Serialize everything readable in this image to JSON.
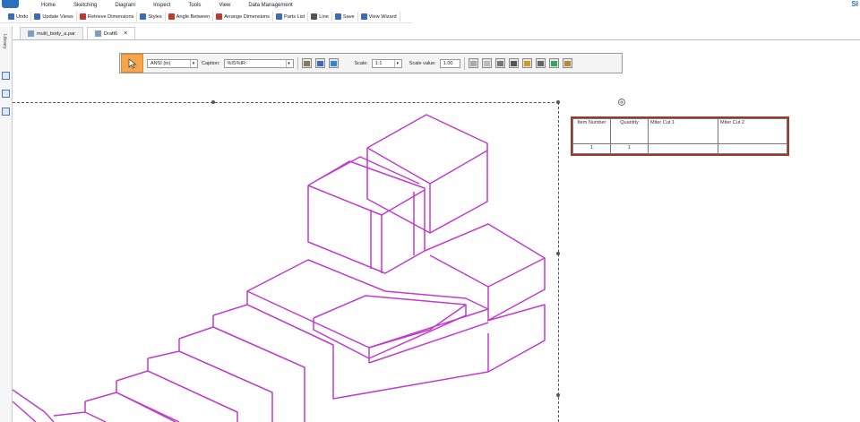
{
  "menu": [
    "Home",
    "Sketching",
    "Diagram",
    "Inspect",
    "Tools",
    "View",
    "Data Management"
  ],
  "brand": "SI",
  "toolbar": [
    {
      "label": "Undo",
      "icon": "undo-icon",
      "color": "#3a6db5"
    },
    {
      "label": "Update Views",
      "icon": "update-views-icon",
      "color": "#3a6db5"
    },
    {
      "label": "Retrieve Dimensions",
      "icon": "retrieve-dimensions-icon",
      "color": "#c0392b"
    },
    {
      "label": "Styles",
      "icon": "styles-icon",
      "color": "#3a6db5"
    },
    {
      "label": "Angle Between",
      "icon": "angle-between-icon",
      "color": "#c0392b"
    },
    {
      "label": "Arrange Dimensions",
      "icon": "arrange-dimensions-icon",
      "color": "#c0392b"
    },
    {
      "label": "Parts List",
      "icon": "parts-list-icon",
      "color": "#3a6db5"
    },
    {
      "label": "Line",
      "icon": "line-icon",
      "color": "#555555"
    },
    {
      "label": "Save",
      "icon": "save-icon",
      "color": "#3a6db5"
    },
    {
      "label": "View Wizard",
      "icon": "view-wizard-icon",
      "color": "#3a6db5"
    }
  ],
  "tabs": [
    {
      "label": "multi_body_a.par",
      "active": false
    },
    {
      "label": "Draft6",
      "active": true,
      "close": "×"
    }
  ],
  "sidebar": {
    "library_label": "Library"
  },
  "ribbon": {
    "style_value": "ANSI (in)",
    "caption_label": "Caption:",
    "caption_value": "%IS%IR",
    "scale_label": "Scale:",
    "scale_value": "1:1",
    "scale_value_label": "Scale value:",
    "scale_value_input": "1.00"
  },
  "parts_list": {
    "headers": [
      "Item Number",
      "Quantity",
      "Miter Cut 1",
      "Miter Cut 2"
    ],
    "rows": [
      [
        "1",
        "1",
        "",
        ""
      ]
    ]
  },
  "colors": {
    "model": "#c03ccc",
    "accent": "#f7a54a",
    "table_border": "#9a3a24"
  }
}
